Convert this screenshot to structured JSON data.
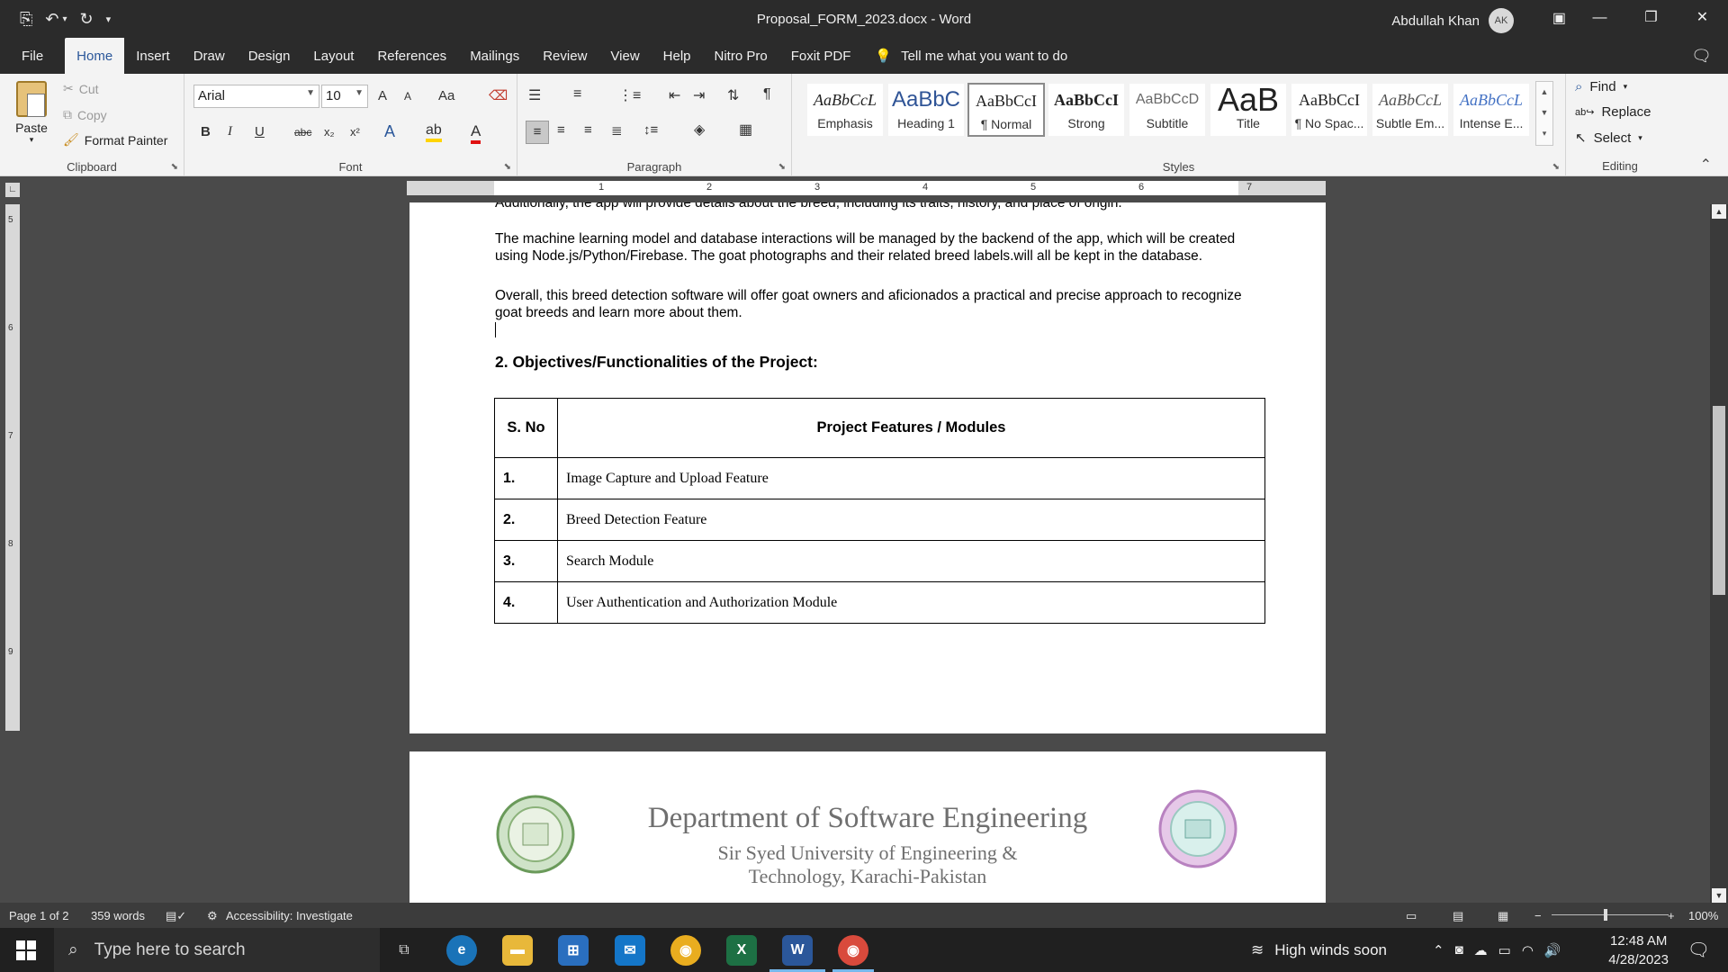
{
  "window": {
    "title": "Proposal_FORM_2023.docx  -  Word",
    "user_name": "Abdullah Khan",
    "user_initials": "AK"
  },
  "menu": {
    "tabs": [
      "File",
      "Home",
      "Insert",
      "Draw",
      "Design",
      "Layout",
      "References",
      "Mailings",
      "Review",
      "View",
      "Help",
      "Nitro Pro",
      "Foxit PDF"
    ],
    "tell_me": "Tell me what you want to do"
  },
  "ribbon": {
    "clipboard": {
      "paste": "Paste",
      "cut": "Cut",
      "copy": "Copy",
      "format_painter": "Format Painter",
      "label": "Clipboard"
    },
    "font": {
      "name": "Arial",
      "size": "10",
      "label": "Font",
      "grow": "A",
      "shrink": "A",
      "case": "Aa"
    },
    "paragraph": {
      "label": "Paragraph"
    },
    "styles": {
      "label": "Styles",
      "items": [
        {
          "sample": "AaBbCcL",
          "name": "Emphasis"
        },
        {
          "sample": "AaBbC",
          "name": "Heading 1"
        },
        {
          "sample": "AaBbCcI",
          "name": "¶ Normal"
        },
        {
          "sample": "AaBbCcI",
          "name": "Strong"
        },
        {
          "sample": "AaBbCcD",
          "name": "Subtitle"
        },
        {
          "sample": "AaB",
          "name": "Title"
        },
        {
          "sample": "AaBbCcI",
          "name": "¶ No Spac..."
        },
        {
          "sample": "AaBbCcL",
          "name": "Subtle Em..."
        },
        {
          "sample": "AaBbCcL",
          "name": "Intense E..."
        }
      ]
    },
    "editing": {
      "find": "Find",
      "replace": "Replace",
      "select": "Select",
      "label": "Editing"
    }
  },
  "rulers": {
    "horizontal": [
      "1",
      "2",
      "3",
      "4",
      "5",
      "6",
      "7"
    ],
    "vertical": [
      "5",
      "6",
      "7",
      "8",
      "9"
    ]
  },
  "document": {
    "partial_line": "Additionally, the app will provide details about the breed, including its traits, history, and place of origin.",
    "para1": "The machine learning model and database interactions will be managed by the backend of the app, which will be created using Node.js/Python/Firebase. The goat photographs and their related breed labels.will all be kept in the database.",
    "para2": "Overall, this breed detection software will offer goat owners and aficionados a practical and precise approach to recognize goat breeds and learn more about them.",
    "heading": "2. Objectives/Functionalities of the Project:",
    "table": {
      "headers": [
        "S. No",
        "Project Features / Modules"
      ],
      "rows": [
        [
          "1.",
          "Image Capture and Upload Feature"
        ],
        [
          "2.",
          "Breed Detection Feature"
        ],
        [
          "3.",
          "Search Module"
        ],
        [
          "4.",
          "User Authentication and Authorization Module"
        ]
      ]
    },
    "page2": {
      "department": "Department of Software Engineering",
      "university_line1": "Sir Syed University of Engineering &",
      "university_line2": "Technology, Karachi-Pakistan"
    }
  },
  "status": {
    "page": "Page 1 of 2",
    "words": "359 words",
    "accessibility": "Accessibility: Investigate",
    "zoom": "100%"
  },
  "taskbar": {
    "search_placeholder": "Type here to search",
    "weather": "High winds soon",
    "time": "12:48 AM",
    "date": "4/28/2023"
  },
  "colors": {
    "word_blue": "#2b579a",
    "titlebar": "#2b2b2b",
    "ribbon_bg": "#f3f3f3",
    "taskbar": "#202020"
  }
}
